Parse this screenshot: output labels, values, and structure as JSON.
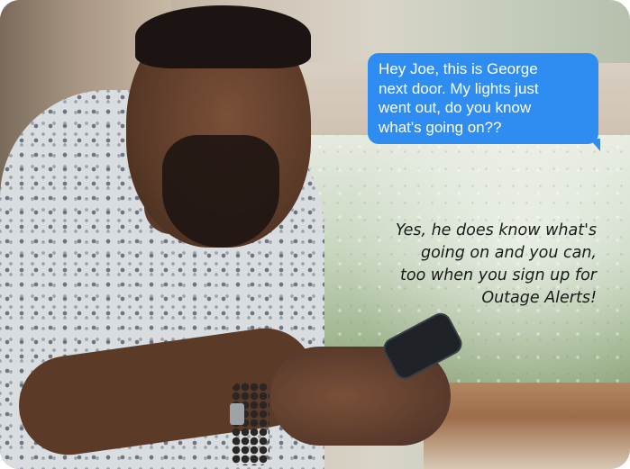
{
  "message": {
    "lines": [
      "Hey Joe, this is George",
      "next door. My lights just",
      "went out, do you know",
      "what's going on??"
    ]
  },
  "caption": {
    "lines": [
      "Yes, he does know what's",
      "going on and you can,",
      "too when you sign up for",
      "Outage Alerts!"
    ]
  },
  "colors": {
    "bubble": "#2f8cf0",
    "bubble_text": "#ffffff",
    "caption_text": "#1a1a1a"
  }
}
